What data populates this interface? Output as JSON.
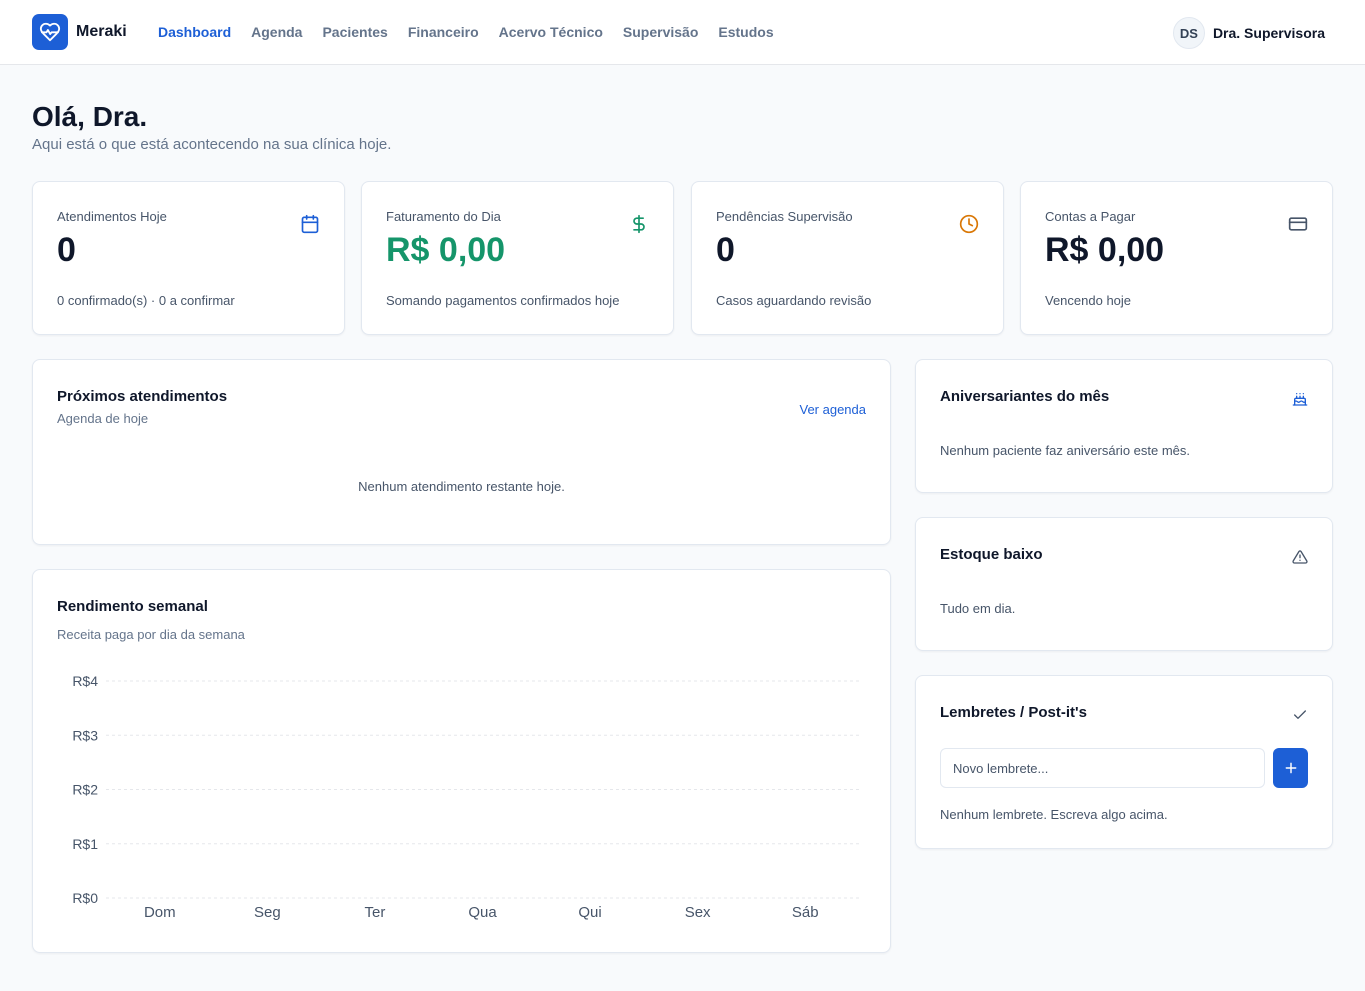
{
  "app": {
    "name": "Meraki"
  },
  "nav": {
    "items": [
      {
        "label": "Dashboard",
        "active": true
      },
      {
        "label": "Agenda",
        "active": false
      },
      {
        "label": "Pacientes",
        "active": false
      },
      {
        "label": "Financeiro",
        "active": false
      },
      {
        "label": "Acervo Técnico",
        "active": false
      },
      {
        "label": "Supervisão",
        "active": false
      },
      {
        "label": "Estudos",
        "active": false
      }
    ]
  },
  "user": {
    "initials": "DS",
    "name": "Dra. Supervisora"
  },
  "greeting": {
    "title": "Olá, Dra.",
    "subtitle": "Aqui está o que está acontecendo na sua clínica hoje."
  },
  "stats": [
    {
      "label": "Atendimentos Hoje",
      "value": "0",
      "sub": "0 confirmado(s) · 0 a confirmar",
      "icon": "calendar-icon",
      "icon_color": "#1d5fd6"
    },
    {
      "label": "Faturamento do Dia",
      "value": "R$ 0,00",
      "sub": "Somando pagamentos confirmados hoje",
      "icon": "dollar-icon",
      "icon_color": "#15956a"
    },
    {
      "label": "Pendências Supervisão",
      "value": "0",
      "sub": "Casos aguardando revisão",
      "icon": "clock-icon",
      "icon_color": "#d97706"
    },
    {
      "label": "Contas a Pagar",
      "value": "R$ 0,00",
      "sub": "Vencendo hoje",
      "icon": "credit-card-icon",
      "icon_color": "#475569"
    }
  ],
  "upcoming": {
    "title": "Próximos atendimentos",
    "subtitle": "Agenda de hoje",
    "link": "Ver agenda",
    "empty": "Nenhum atendimento restante hoje."
  },
  "weekly": {
    "title": "Rendimento semanal",
    "subtitle": "Receita paga por dia da semana"
  },
  "birthdays": {
    "title": "Aniversariantes do mês",
    "empty": "Nenhum paciente faz aniversário este mês.",
    "icon": "cake-icon"
  },
  "stock": {
    "title": "Estoque baixo",
    "empty": "Tudo em dia.",
    "icon": "warning-icon"
  },
  "reminders": {
    "title": "Lembretes / Post-it's",
    "placeholder": "Novo lembrete...",
    "empty": "Nenhum lembrete. Escreva algo acima.",
    "icon": "check-icon"
  },
  "colors": {
    "primary": "#1d5fd6",
    "success": "#15956a",
    "warning": "#d97706"
  },
  "chart_data": {
    "type": "line",
    "categories": [
      "Dom",
      "Seg",
      "Ter",
      "Qua",
      "Qui",
      "Sex",
      "Sáb"
    ],
    "series": [
      {
        "values": [
          0,
          0,
          0,
          0,
          0,
          0,
          0
        ]
      }
    ],
    "y_ticks": [
      "R$0",
      "R$1",
      "R$2",
      "R$3",
      "R$4"
    ],
    "ylim": [
      0,
      4
    ],
    "grid": true,
    "title": "",
    "xlabel": "",
    "ylabel": ""
  }
}
